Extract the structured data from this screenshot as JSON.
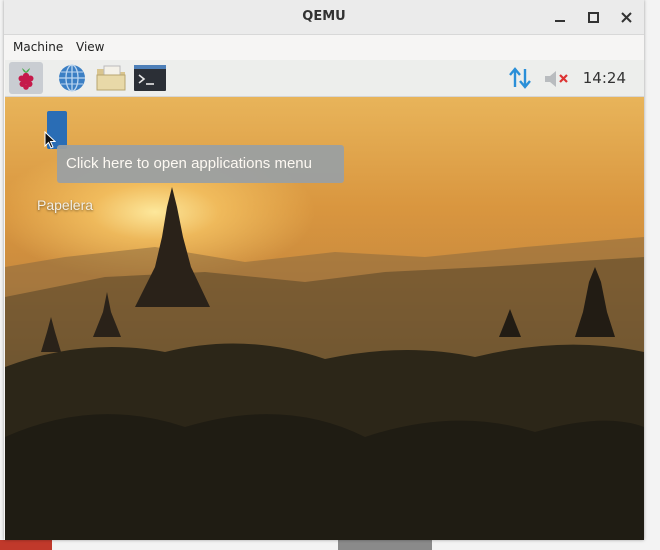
{
  "window": {
    "title": "QEMU"
  },
  "menubar": {
    "items": [
      "Machine",
      "View"
    ]
  },
  "panel": {
    "launchers": [
      "raspberry-menu-icon",
      "web-browser-icon",
      "file-manager-icon",
      "terminal-icon"
    ],
    "clock": "14:24"
  },
  "tooltip": {
    "text": "Click here to open applications menu"
  },
  "desktop": {
    "trash_label": "Papelera"
  },
  "colors": {
    "panel": "#edeeec",
    "tooltip": "#9aa0a4",
    "raspberry": "#c51a4a"
  }
}
